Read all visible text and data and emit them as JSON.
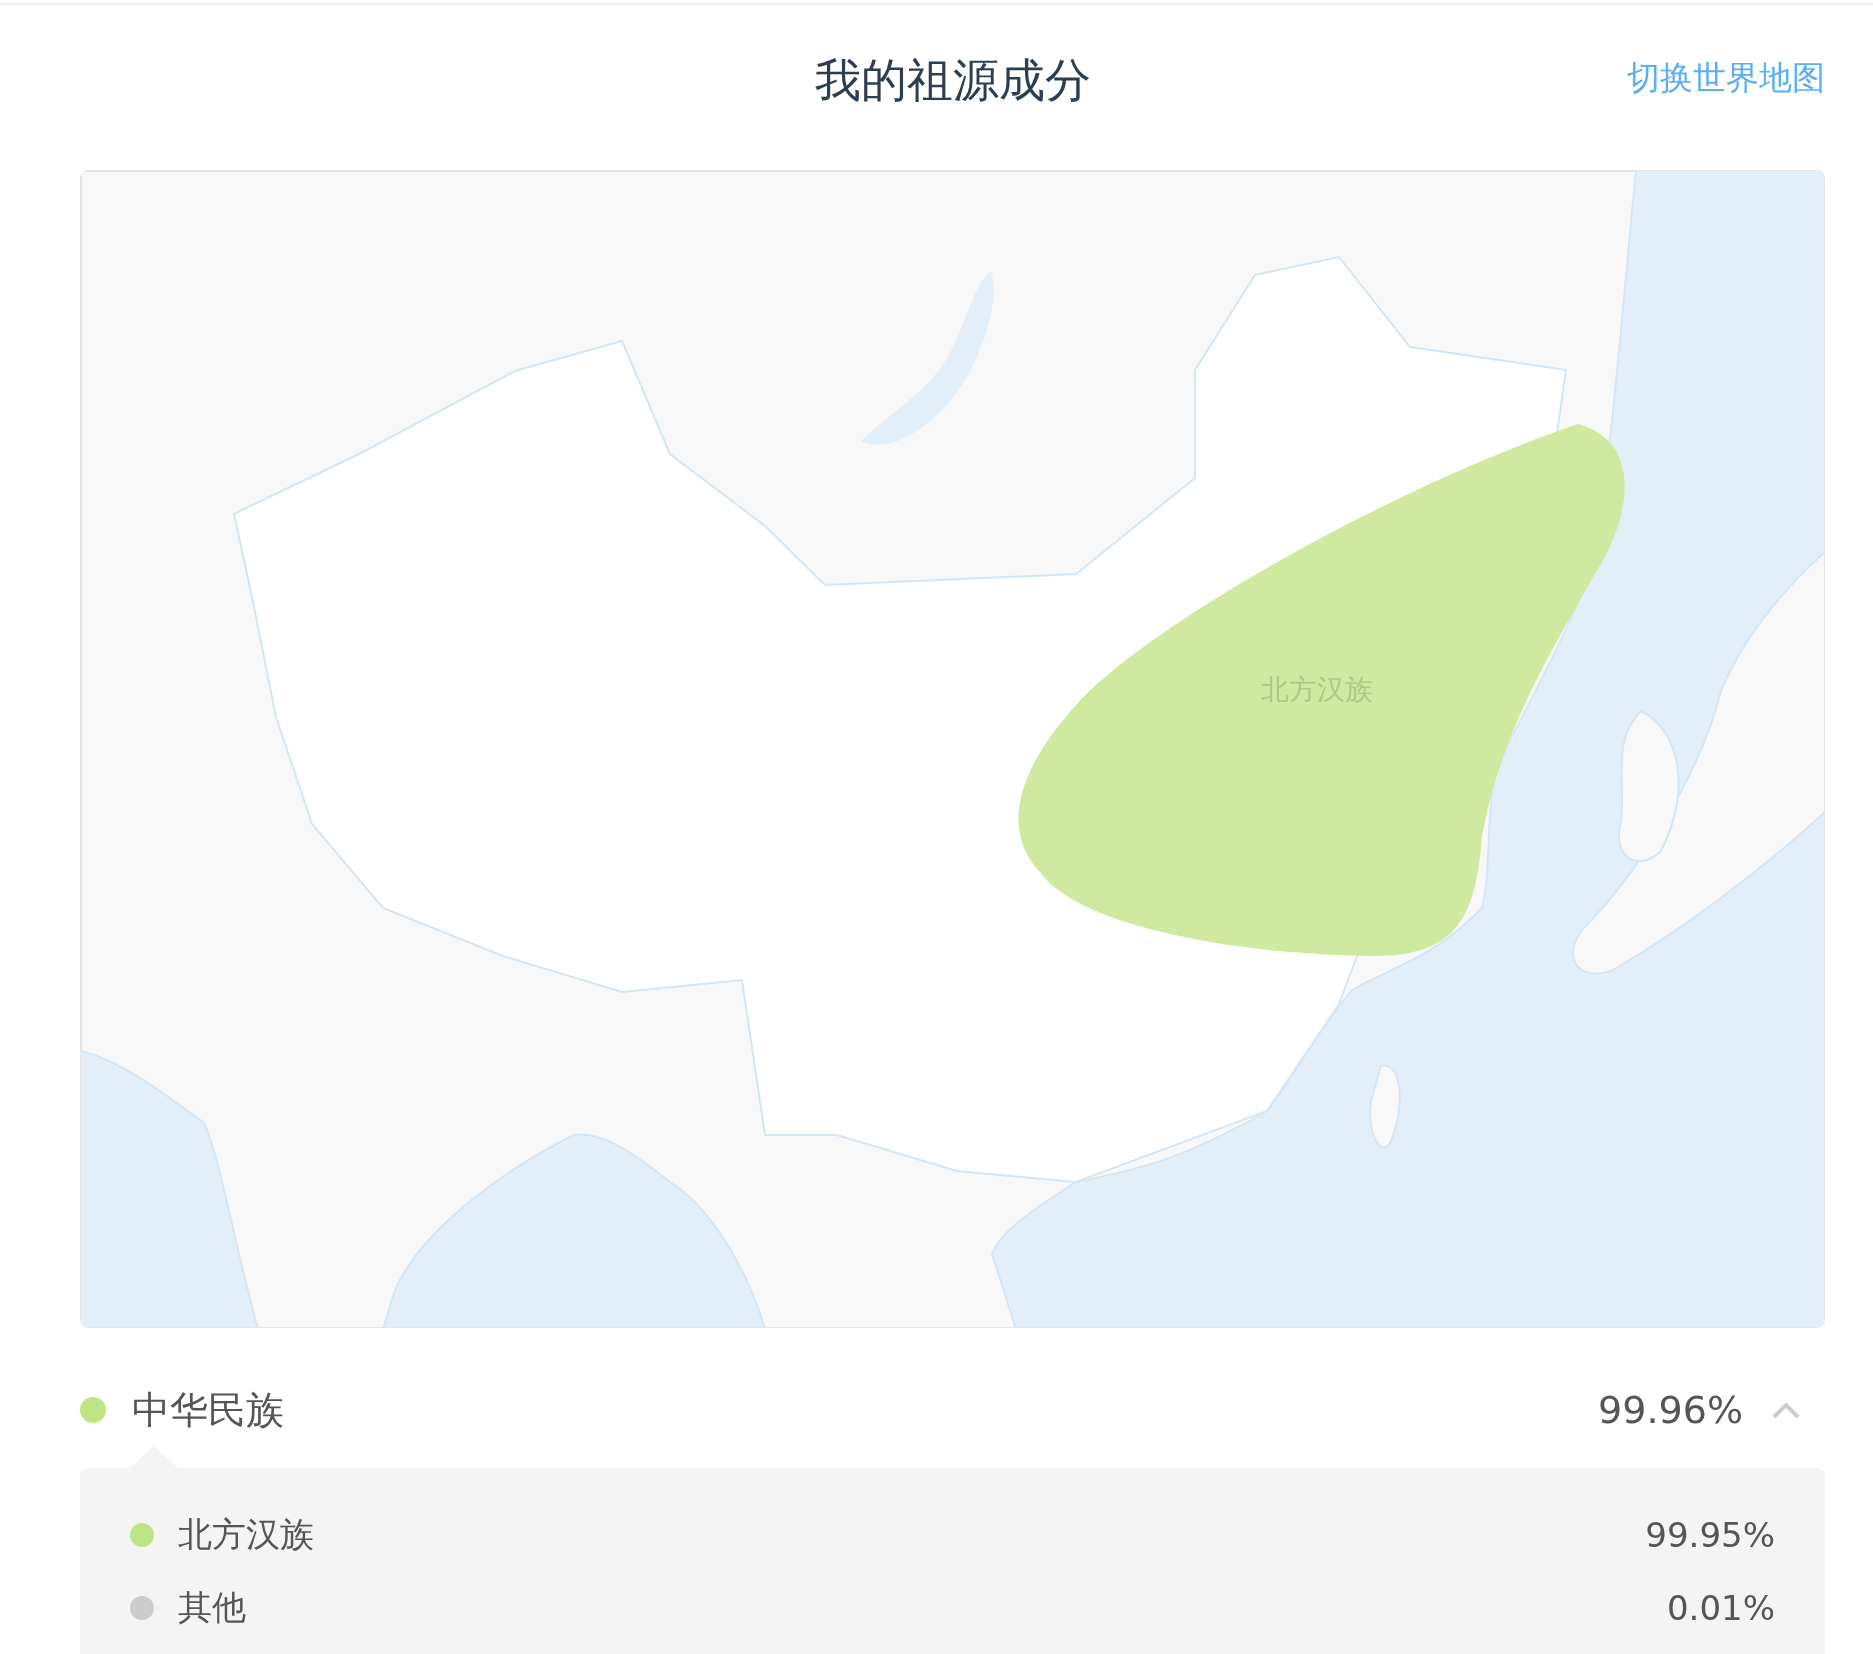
{
  "header": {
    "title": "我的祖源成分",
    "switch_link": "切换世界地图"
  },
  "map": {
    "regions": [
      {
        "label": "北方汉族",
        "color": "#cfeaa0"
      }
    ]
  },
  "groups": [
    {
      "name": "中华民族",
      "percent": "99.96%",
      "color": "#bde585",
      "expanded": true,
      "children": [
        {
          "name": "北方汉族",
          "percent": "99.95%",
          "color": "#bde585"
        },
        {
          "name": "其他",
          "percent": "0.01%",
          "color": "#cccccc"
        }
      ]
    }
  ]
}
